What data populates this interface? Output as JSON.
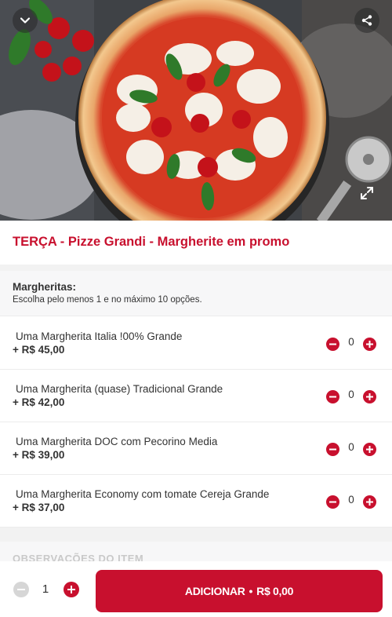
{
  "item": {
    "title": "TERÇA - Pizze Grandi - Margherite em promo"
  },
  "icons": {
    "back": "chevron-down-icon",
    "share": "share-icon",
    "expand": "expand-icon"
  },
  "group": {
    "title": "Margheritas:",
    "subtitle": "Escolha pelo menos 1 e no máximo 10 opções.",
    "options": [
      {
        "name": "Uma Margherita Italia !00% Grande",
        "price": "+ R$ 45,00",
        "qty": "0"
      },
      {
        "name": "Uma Margherita (quase) Tradicional Grande",
        "price": "+ R$ 42,00",
        "qty": "0"
      },
      {
        "name": "Uma Margherita DOC com Pecorino Media",
        "price": "+ R$ 39,00",
        "qty": "0"
      },
      {
        "name": "Uma Margherita Economy com tomate Cereja Grande",
        "price": "+ R$ 37,00",
        "qty": "0"
      }
    ]
  },
  "observations": {
    "label": "OBSERVAÇÕES DO ITEM"
  },
  "footer": {
    "quantity": "1",
    "add_label": "ADICIONAR",
    "separator": "•",
    "total": "R$ 0,00"
  },
  "colors": {
    "accent": "#c8102e",
    "disabled": "#d6d6d6"
  }
}
